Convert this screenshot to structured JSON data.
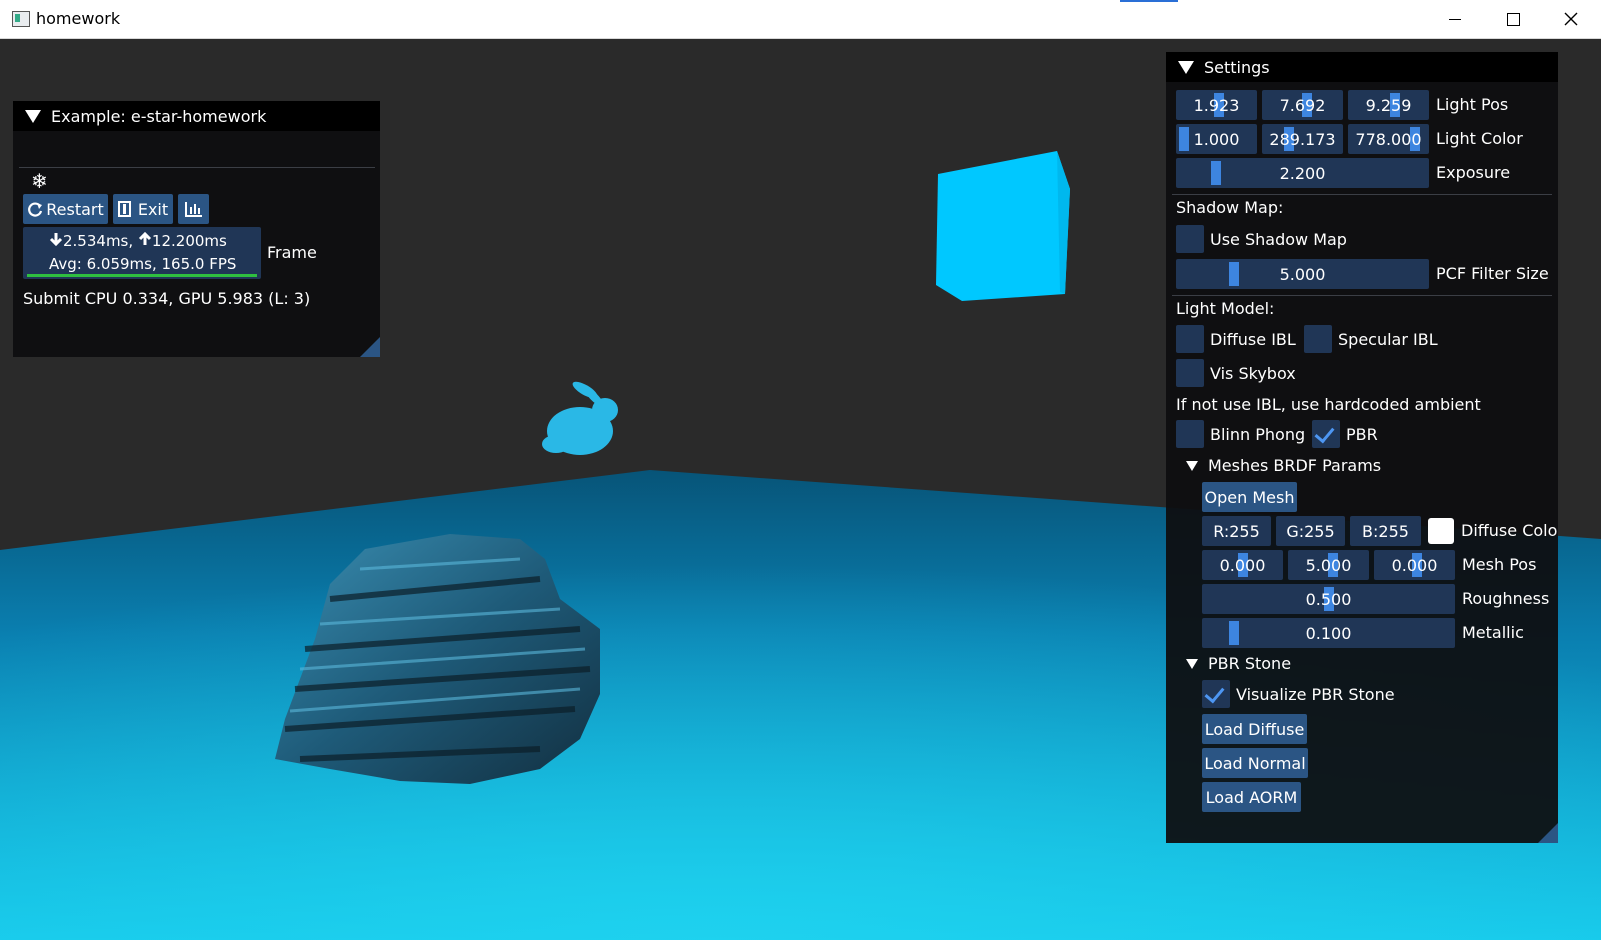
{
  "window": {
    "title": "homework"
  },
  "example_panel": {
    "title": "Example: e-star-homework",
    "snow_icon": "❄",
    "restart_label": "Restart",
    "exit_label": "Exit",
    "frame_stats_line1_down": "2.534ms,",
    "frame_stats_line1_up": "12.200ms",
    "frame_stats_line2": "Avg: 6.059ms, 165.0 FPS",
    "frame_label": "Frame",
    "submit_text": "Submit CPU 0.334, GPU 5.983 (L: 3)"
  },
  "settings_panel": {
    "title": "Settings",
    "light_pos": {
      "values": [
        "1.923",
        "7.692",
        "9.259"
      ],
      "label": "Light Pos"
    },
    "light_color": {
      "values": [
        "1.000",
        "289.173",
        "778.000"
      ],
      "label": "Light Color"
    },
    "exposure": {
      "value": "2.200",
      "label": "Exposure"
    },
    "shadow_map_header": "Shadow Map:",
    "use_shadow_map": {
      "label": "Use Shadow Map",
      "checked": false
    },
    "pcf_filter": {
      "value": "5.000",
      "label": "PCF Filter Size"
    },
    "light_model_header": "Light Model:",
    "diffuse_ibl": {
      "label": "Diffuse IBL",
      "checked": false
    },
    "specular_ibl": {
      "label": "Specular IBL",
      "checked": false
    },
    "vis_skybox": {
      "label": "Vis Skybox",
      "checked": false
    },
    "ibl_note": "If not use IBL, use hardcoded ambient",
    "blinn_phong": {
      "label": "Blinn Phong",
      "checked": false
    },
    "pbr": {
      "label": "PBR",
      "checked": true
    },
    "meshes_header": "Meshes BRDF Params",
    "open_mesh_label": "Open Mesh",
    "diffuse_color": {
      "r": "R:255",
      "g": "G:255",
      "b": "B:255",
      "label": "Diffuse Colo"
    },
    "mesh_pos": {
      "values": [
        "0.000",
        "5.000",
        "0.000"
      ],
      "label": "Mesh Pos"
    },
    "roughness": {
      "value": "0.500",
      "label": "Roughness"
    },
    "metallic": {
      "value": "0.100",
      "label": "Metallic"
    },
    "pbr_stone_header": "PBR Stone",
    "visualize_pbr_stone": {
      "label": "Visualize PBR Stone",
      "checked": true
    },
    "load_diffuse_label": "Load Diffuse",
    "load_normal_label": "Load Normal",
    "load_aorm_label": "Load AORM"
  },
  "colors": {
    "accent": "#3d85e0",
    "frame_bg": "#203656",
    "button": "#2b5584",
    "cube": "#00c8ff",
    "floor": "#0aa3d6"
  }
}
